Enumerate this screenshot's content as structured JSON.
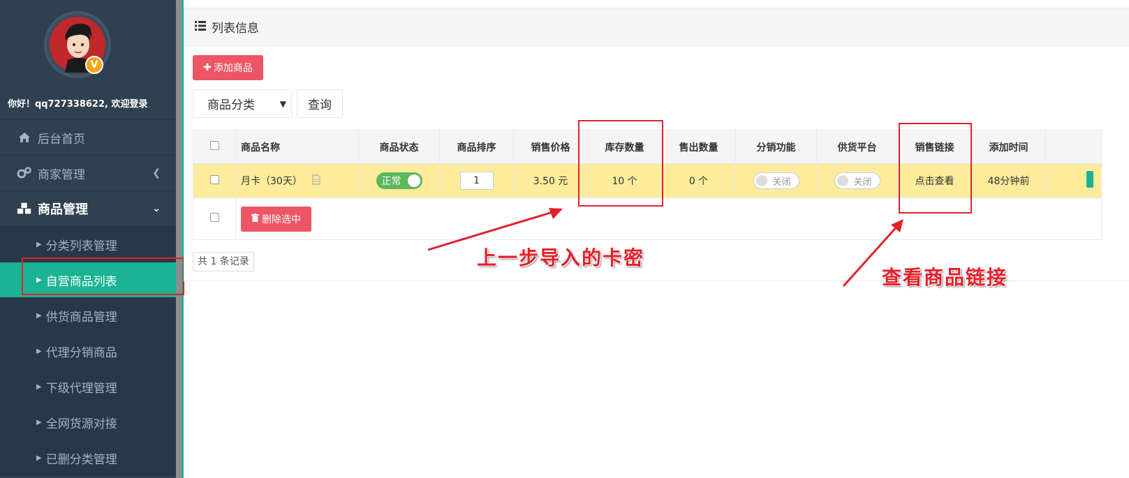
{
  "user": {
    "greeting": "你好！qq727338622, 欢迎登录",
    "badge": "V"
  },
  "sidebar": {
    "items": [
      {
        "label": "后台首页",
        "icon": "home-icon"
      },
      {
        "label": "商家管理",
        "icon": "cogs-icon"
      },
      {
        "label": "商品管理",
        "icon": "cubes-icon"
      }
    ],
    "sub_items": [
      {
        "label": "分类列表管理"
      },
      {
        "label": "自营商品列表"
      },
      {
        "label": "供货商品管理"
      },
      {
        "label": "代理分销商品"
      },
      {
        "label": "下级代理管理"
      },
      {
        "label": "全网货源对接"
      },
      {
        "label": "已删分类管理"
      }
    ]
  },
  "panel": {
    "title": "列表信息",
    "add_button": "添加商品",
    "category_select": "商品分类",
    "query_button": "查询",
    "delete_button": "删除选中",
    "total_text": "共 1 条记录"
  },
  "table": {
    "headers": [
      "商品名称",
      "商品状态",
      "商品排序",
      "销售价格",
      "库存数量",
      "售出数量",
      "分销功能",
      "供货平台",
      "销售链接",
      "添加时间"
    ],
    "row": {
      "name": "月卡（30天）",
      "status": "正常",
      "sort": "1",
      "price": "3.50 元",
      "stock": "10 个",
      "sold": "0 个",
      "distribution": "关闭",
      "supply": "关闭",
      "link": "点击查看",
      "added": "48分钟前"
    }
  },
  "annotations": {
    "stock_note": "上一步导入的卡密",
    "link_note": "查看商品链接"
  },
  "colors": {
    "sidebar": "#2f4050",
    "accent": "#1ab394",
    "danger": "#ed5565",
    "highlight_row": "#fcec9c",
    "annotation": "#e3202a"
  }
}
